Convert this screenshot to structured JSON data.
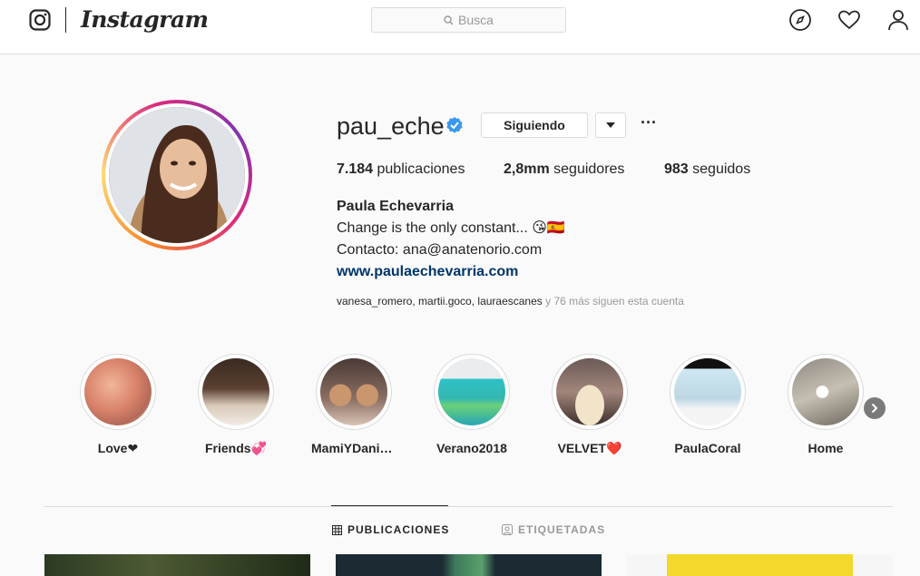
{
  "nav": {
    "wordmark": "Instagram",
    "search_placeholder": "Busca",
    "icons": [
      "instagram-glyph-icon",
      "search-icon",
      "explore-compass-icon",
      "activity-heart-icon",
      "profile-person-icon"
    ]
  },
  "profile": {
    "username": "pau_eche",
    "verified": true,
    "follow_label": "Siguiendo",
    "more_label": "···",
    "stats": {
      "posts_value": "7.184",
      "posts_label": "publicaciones",
      "followers_value": "2,8mm",
      "followers_label": "seguidores",
      "following_value": "983",
      "following_label": "seguidos"
    },
    "bio": {
      "full_name": "Paula Echevarria",
      "line1": "Change is the only constant... 😘🇪🇸",
      "line2": "Contacto: ana@anatenorio.com",
      "link": "www.paulaechevarria.com"
    },
    "followed_by": {
      "names": "vanesa_romero, martii.goco, lauraescanes",
      "suffix": " y 76 más siguen esta cuenta"
    }
  },
  "highlights": [
    {
      "label": "Love❤"
    },
    {
      "label": "Friends💞"
    },
    {
      "label": "MamiYDaniella"
    },
    {
      "label": "Verano2018"
    },
    {
      "label": "VELVET❤️"
    },
    {
      "label": "PaulaCoral"
    },
    {
      "label": "Home"
    }
  ],
  "tabs": [
    {
      "label": "PUBLICACIONES",
      "active": true,
      "icon": "grid-icon"
    },
    {
      "label": "ETIQUETADAS",
      "active": false,
      "icon": "tagged-icon"
    }
  ],
  "colors": {
    "link": "#003569",
    "verified": "#3897f0",
    "border": "#dbdbdb",
    "text": "#262626",
    "muted": "#999999"
  }
}
